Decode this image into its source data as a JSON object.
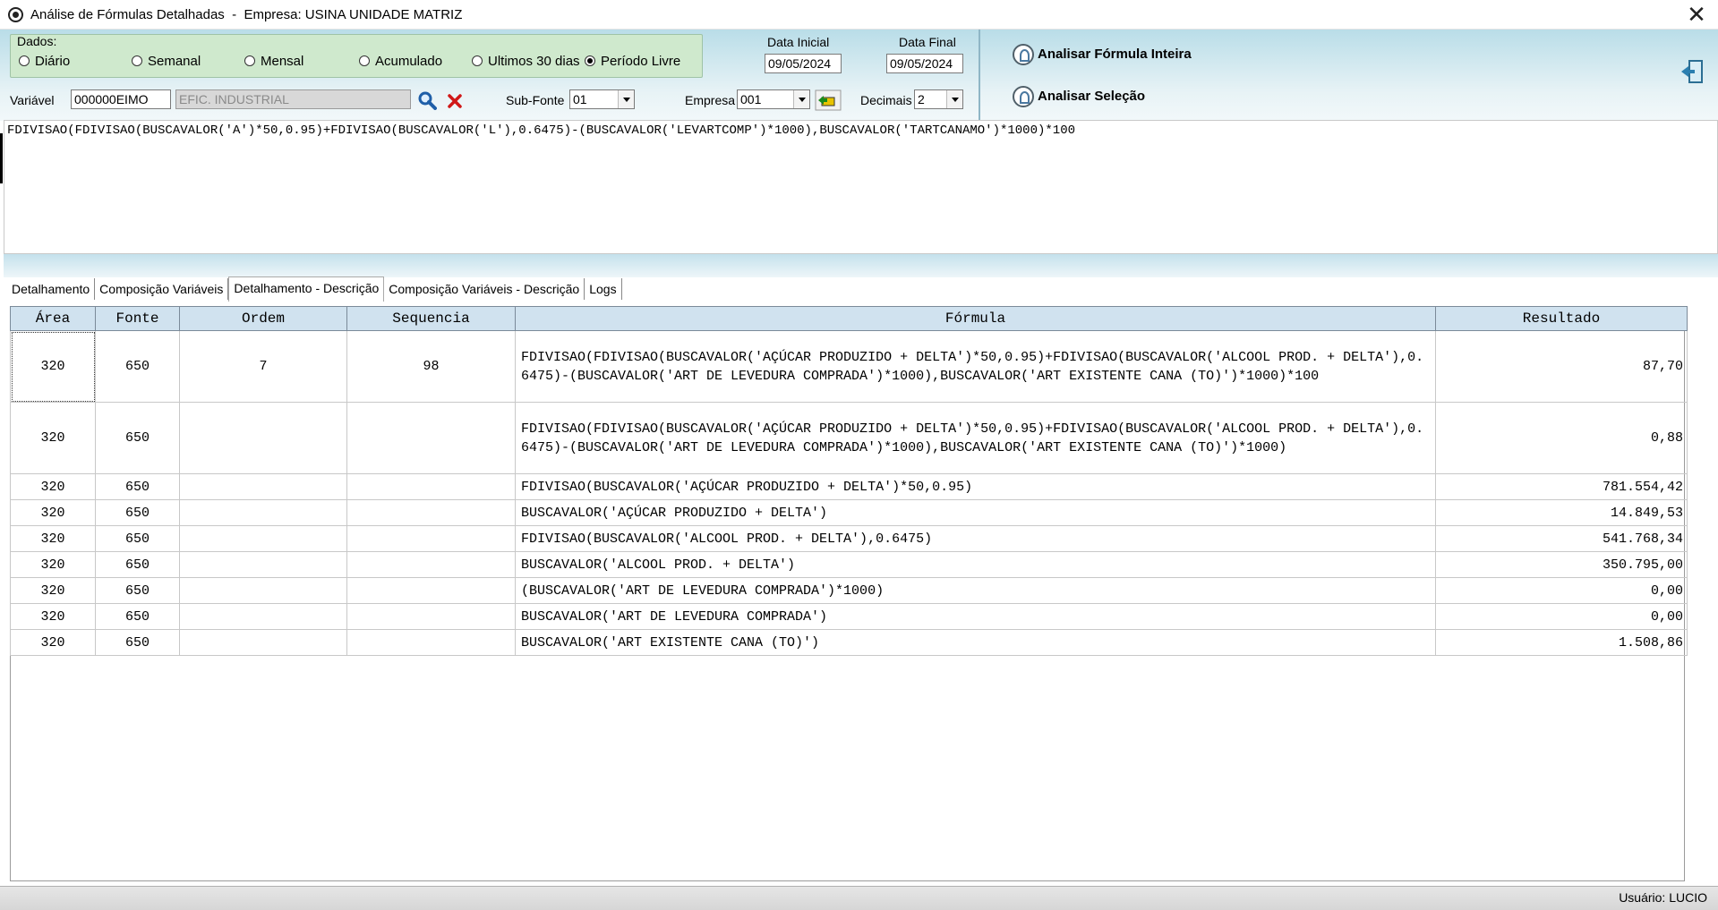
{
  "window": {
    "title": "Análise de Fórmulas Detalhadas  -  Empresa: USINA UNIDADE MATRIZ",
    "close_glyph": "✕"
  },
  "dados": {
    "label": "Dados:",
    "options": [
      {
        "label": "Diário",
        "selected": false
      },
      {
        "label": "Semanal",
        "selected": false
      },
      {
        "label": "Mensal",
        "selected": false
      },
      {
        "label": "Acumulado",
        "selected": false
      },
      {
        "label": "Ultimos 30 dias",
        "selected": false
      },
      {
        "label": "Período Livre",
        "selected": true
      }
    ]
  },
  "dates": {
    "inicial_label": "Data Inicial",
    "inicial_value": "09/05/2024",
    "final_label": "Data Final",
    "final_value": "09/05/2024"
  },
  "actions": {
    "analisar_inteira": "Analisar Fórmula Inteira",
    "analisar_selecao": "Analisar Seleção"
  },
  "variavel": {
    "label": "Variável",
    "code": "000000EIMO",
    "description": "EFIC. INDUSTRIAL"
  },
  "subfonte": {
    "label": "Sub-Fonte",
    "value": "01"
  },
  "empresa": {
    "label": "Empresa",
    "value": "001"
  },
  "decimais": {
    "label": "Decimais",
    "value": "2"
  },
  "formula": "FDIVISAO(FDIVISAO(BUSCAVALOR('A')*50,0.95)+FDIVISAO(BUSCAVALOR('L'),0.6475)-(BUSCAVALOR('LEVARTCOMP')*1000),BUSCAVALOR('TARTCANAMO')*1000)*100",
  "tabs": [
    {
      "label": "Detalhamento",
      "active": false
    },
    {
      "label": "Composição Variáveis",
      "active": false
    },
    {
      "label": "Detalhamento - Descrição",
      "active": true
    },
    {
      "label": "Composição Variáveis - Descrição",
      "active": false
    },
    {
      "label": "Logs",
      "active": false
    }
  ],
  "grid": {
    "columns": [
      "Área",
      "Fonte",
      "Ordem",
      "Sequencia",
      "Fórmula",
      "Resultado"
    ],
    "rows": [
      {
        "area": "320",
        "fonte": "650",
        "ordem": "7",
        "sequencia": "98",
        "formula": "FDIVISAO(FDIVISAO(BUSCAVALOR('AÇÚCAR PRODUZIDO + DELTA')*50,0.95)+FDIVISAO(BUSCAVALOR('ALCOOL PROD. + DELTA'),0.6475)-(BUSCAVALOR('ART DE LEVEDURA COMPRADA')*1000),BUSCAVALOR('ART EXISTENTE CANA (TO)')*1000)*100",
        "resultado": "87,70"
      },
      {
        "area": "320",
        "fonte": "650",
        "ordem": "",
        "sequencia": "",
        "formula": "FDIVISAO(FDIVISAO(BUSCAVALOR('AÇÚCAR PRODUZIDO + DELTA')*50,0.95)+FDIVISAO(BUSCAVALOR('ALCOOL PROD. + DELTA'),0.6475)-(BUSCAVALOR('ART DE LEVEDURA COMPRADA')*1000),BUSCAVALOR('ART EXISTENTE CANA (TO)')*1000)",
        "resultado": "0,88"
      },
      {
        "area": "320",
        "fonte": "650",
        "ordem": "",
        "sequencia": "",
        "formula": "FDIVISAO(BUSCAVALOR('AÇÚCAR PRODUZIDO + DELTA')*50,0.95)",
        "resultado": "781.554,42"
      },
      {
        "area": "320",
        "fonte": "650",
        "ordem": "",
        "sequencia": "",
        "formula": "BUSCAVALOR('AÇÚCAR PRODUZIDO + DELTA')",
        "resultado": "14.849,53"
      },
      {
        "area": "320",
        "fonte": "650",
        "ordem": "",
        "sequencia": "",
        "formula": "FDIVISAO(BUSCAVALOR('ALCOOL PROD. + DELTA'),0.6475)",
        "resultado": "541.768,34"
      },
      {
        "area": "320",
        "fonte": "650",
        "ordem": "",
        "sequencia": "",
        "formula": "BUSCAVALOR('ALCOOL PROD. + DELTA')",
        "resultado": "350.795,00"
      },
      {
        "area": "320",
        "fonte": "650",
        "ordem": "",
        "sequencia": "",
        "formula": "(BUSCAVALOR('ART DE LEVEDURA COMPRADA')*1000)",
        "resultado": "0,00"
      },
      {
        "area": "320",
        "fonte": "650",
        "ordem": "",
        "sequencia": "",
        "formula": "BUSCAVALOR('ART DE LEVEDURA COMPRADA')",
        "resultado": "0,00"
      },
      {
        "area": "320",
        "fonte": "650",
        "ordem": "",
        "sequencia": "",
        "formula": "BUSCAVALOR('ART EXISTENTE CANA (TO)')",
        "resultado": "1.508,86"
      }
    ]
  },
  "status": {
    "user": "Usuário: LUCIO"
  }
}
